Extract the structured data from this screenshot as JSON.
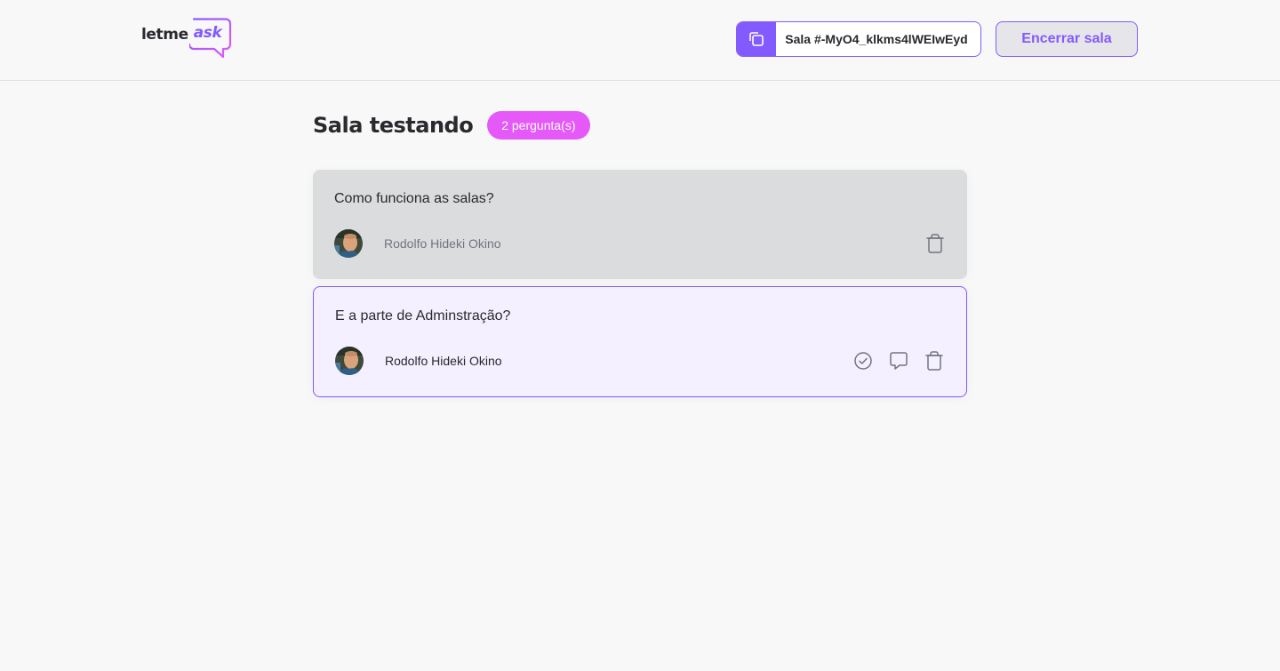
{
  "header": {
    "logo": {
      "part1": "letme",
      "part2": "ask"
    },
    "room_code": {
      "label": "Sala #-MyO4_klkms4lWEIwEyd",
      "copy_icon": "copy-icon"
    },
    "close_room_label": "Encerrar sala"
  },
  "room": {
    "title": "Sala testando",
    "question_count": "2 pergunta(s)"
  },
  "questions": [
    {
      "content": "Como funciona as salas?",
      "author": "Rodolfo Hideki Okino",
      "state": "answered",
      "actions": [
        "trash-icon"
      ]
    },
    {
      "content": "E a parte de Adminstração?",
      "author": "Rodolfo Hideki Okino",
      "state": "highlighted",
      "actions": [
        "check-circle-icon",
        "message-icon",
        "trash-icon"
      ]
    }
  ],
  "colors": {
    "primary": "#835afd",
    "pink": "#e559f9",
    "background": "#f8f8f8",
    "answered_bg": "#dbdcdd",
    "highlighted_bg": "#f4f0ff"
  }
}
